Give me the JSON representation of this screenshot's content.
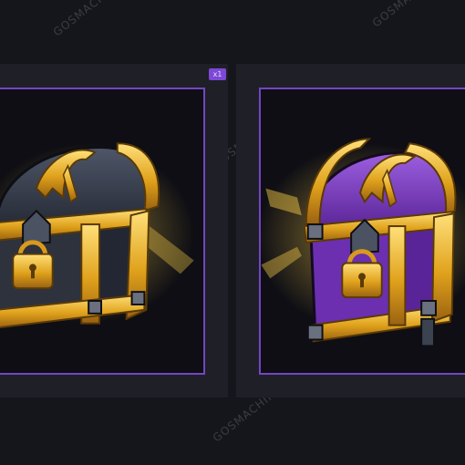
{
  "badge_label": "x1",
  "watermark": "GOSMACHINE",
  "items": [
    {
      "name": "dark-chest",
      "body_color": "#3a4150",
      "lock_icon": "padlock-icon",
      "emblem_icon": "rune-emblem-icon"
    },
    {
      "name": "purple-chest",
      "body_color": "#7a3bc0",
      "lock_icon": "padlock-icon",
      "emblem_icon": "rune-emblem-icon"
    }
  ],
  "colors": {
    "accent": "#7445c2",
    "gold": "#e0a21c",
    "background": "#15151c"
  }
}
